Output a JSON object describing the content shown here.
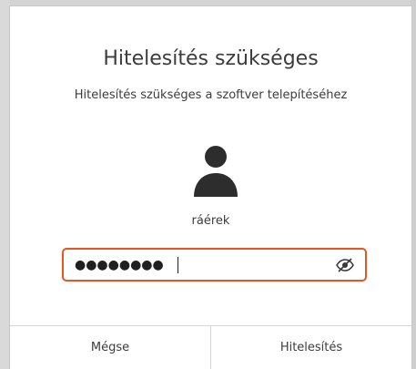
{
  "dialog": {
    "title": "Hitelesítés szükséges",
    "subtitle": "Hitelesítés szükséges a szoftver telepítéséhez",
    "user": {
      "name": "ráérek",
      "avatar_icon": "user-avatar-icon"
    },
    "password": {
      "masked_value": "●●●●●●●●",
      "reveal_icon": "eye-slash-icon"
    },
    "buttons": {
      "cancel": "Mégse",
      "authenticate": "Hitelesítés"
    },
    "colors": {
      "focus_border": "#e95420",
      "text": "#3c3c3c"
    }
  }
}
